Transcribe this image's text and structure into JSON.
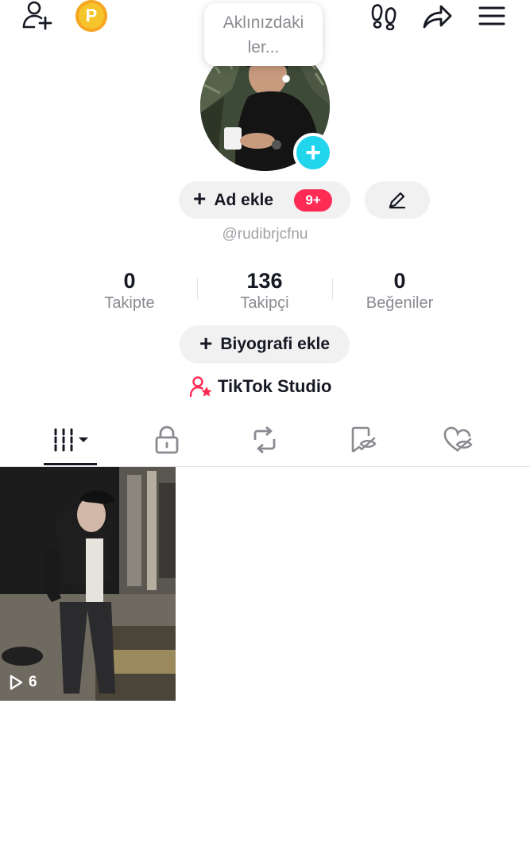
{
  "header": {
    "icons": [
      "add-friend-icon",
      "coin-icon",
      "footprint-icon",
      "share-icon",
      "menu-icon"
    ],
    "coin_letter": "P"
  },
  "note_bubble": {
    "line1": "Aklınızdaki",
    "line2": "ler..."
  },
  "profile": {
    "add_name_label": "Ad ekle",
    "notification_badge": "9+",
    "username": "@rudibrjcfnu"
  },
  "stats": {
    "following": {
      "value": "0",
      "label": "Takipte"
    },
    "followers": {
      "value": "136",
      "label": "Takipçi"
    },
    "likes": {
      "value": "0",
      "label": "Beğeniler"
    }
  },
  "bio_button_label": "Biyografi ekle",
  "studio_label": "TikTok Studio",
  "tabs": [
    "videos-tab",
    "private-tab",
    "reposts-tab",
    "favorites-tab",
    "liked-tab"
  ],
  "videos": [
    {
      "views": "6"
    }
  ],
  "colors": {
    "accent": "#fe2c55",
    "avatar_plus": "#20d5ec",
    "coin": "#f5c52b"
  }
}
